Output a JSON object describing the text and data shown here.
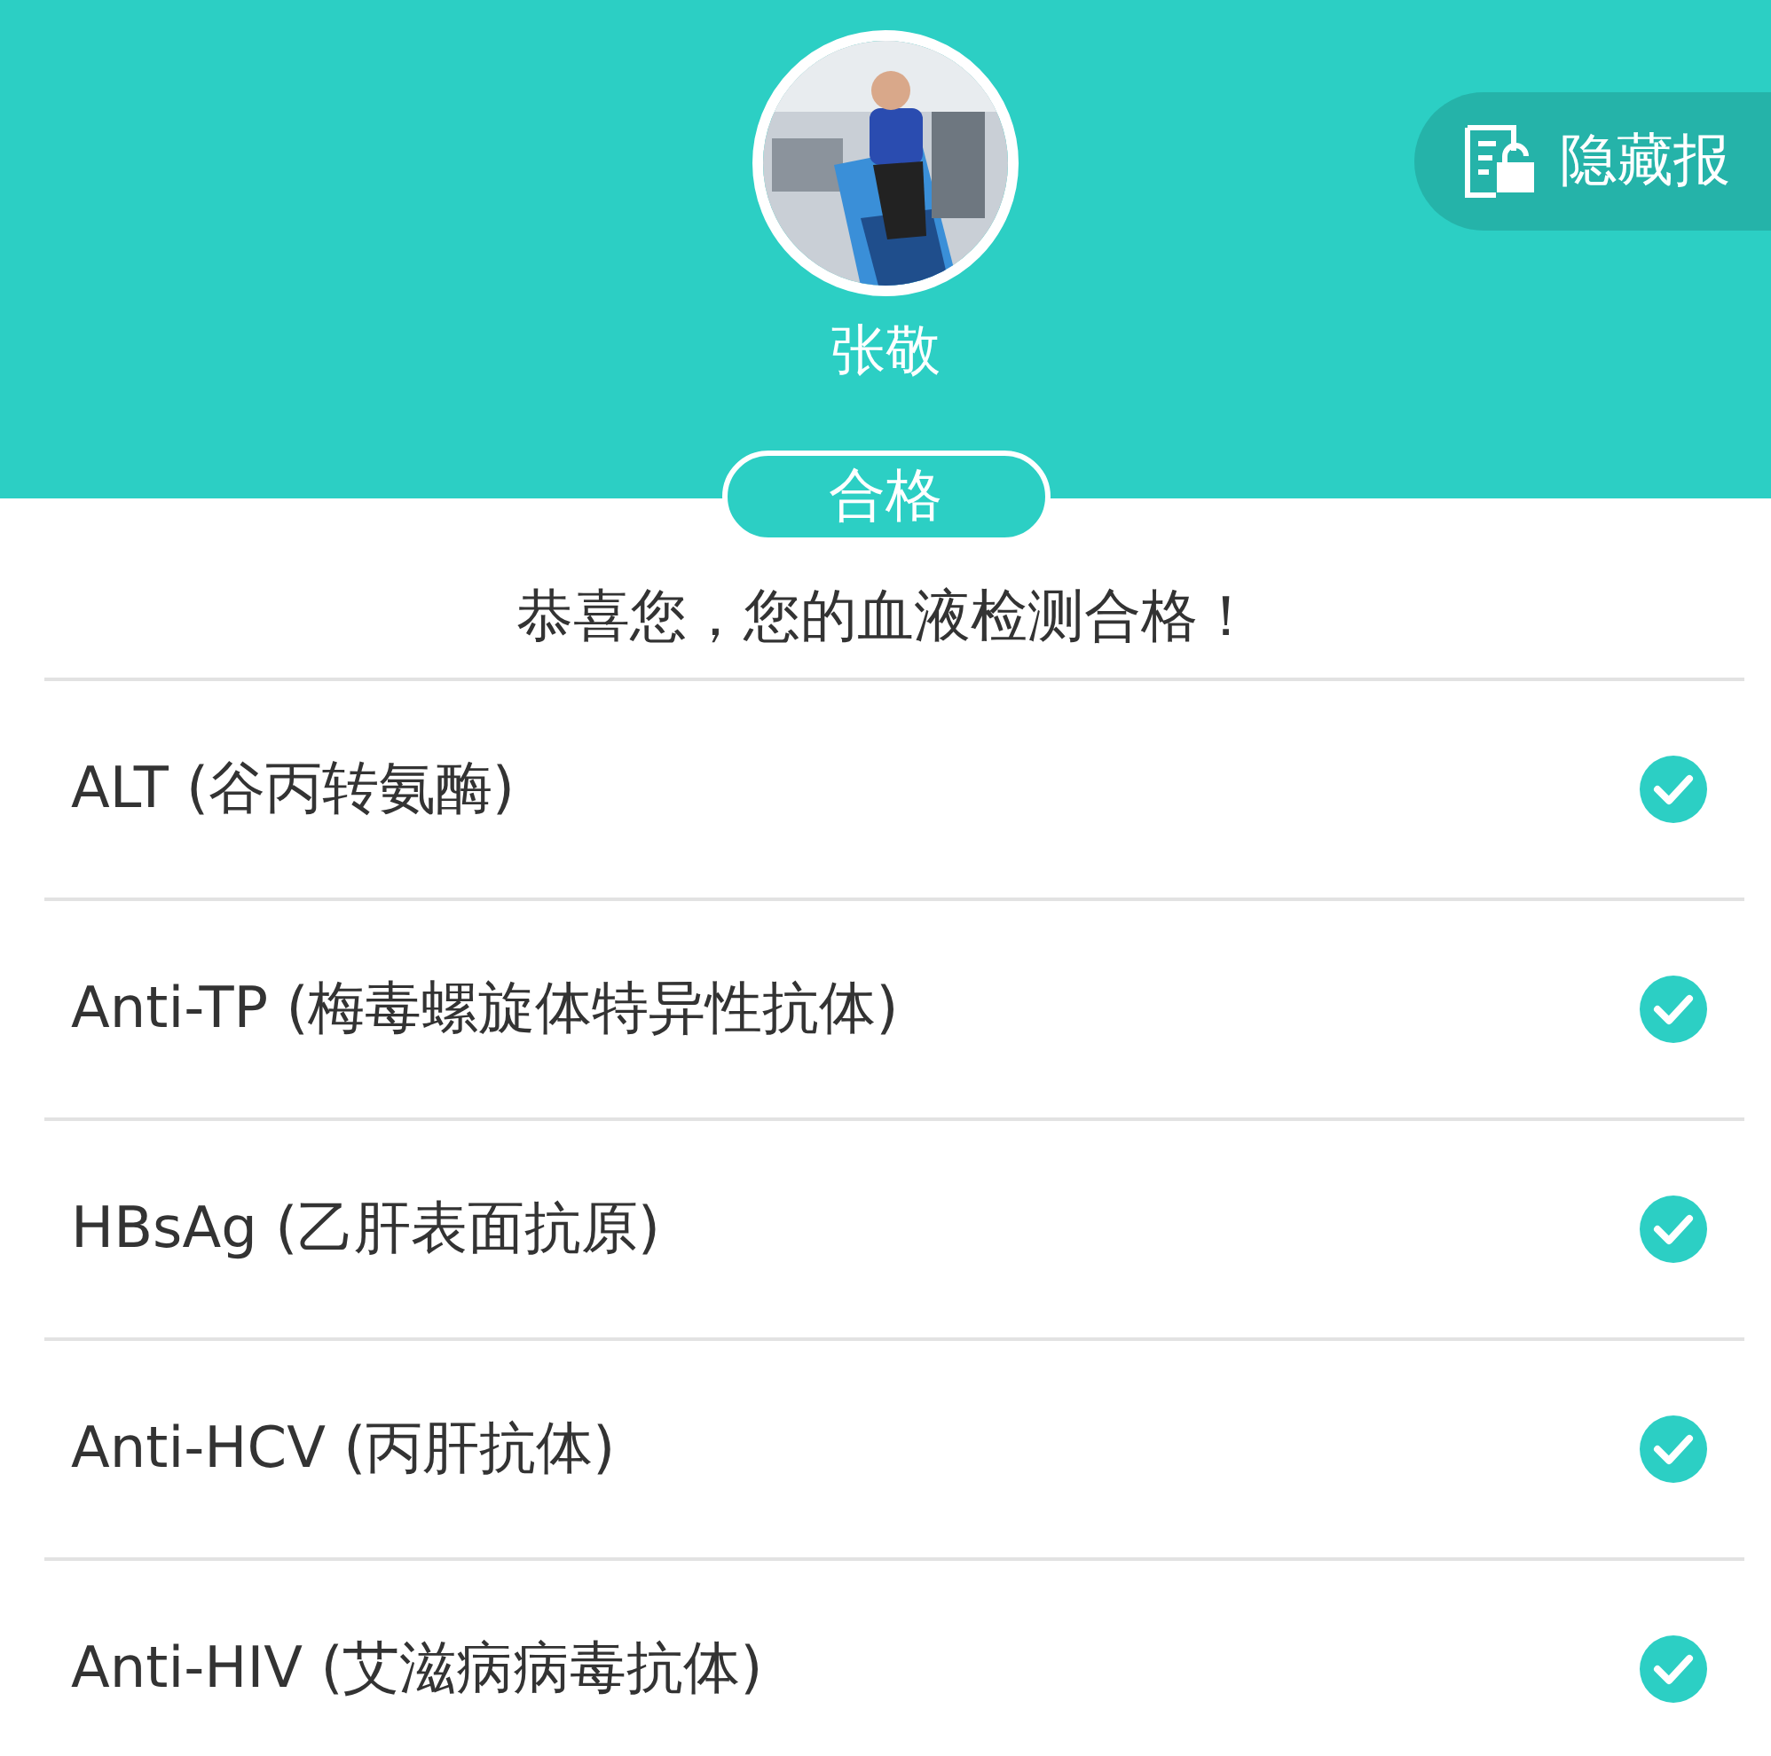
{
  "header": {
    "name": "张敬",
    "hide_button": {
      "label": "隐藏报"
    }
  },
  "result": {
    "badge": "合格",
    "message": "恭喜您，您的血液检测合格！"
  },
  "tests": [
    {
      "label": "ALT (谷丙转氨酶)",
      "passed": true
    },
    {
      "label": "Anti-TP (梅毒螺旋体特异性抗体)",
      "passed": true
    },
    {
      "label": "HBsAg (乙肝表面抗原)",
      "passed": true
    },
    {
      "label": "Anti-HCV (丙肝抗体)",
      "passed": true
    },
    {
      "label": "Anti-HIV (艾滋病病毒抗体)",
      "passed": true
    }
  ]
}
